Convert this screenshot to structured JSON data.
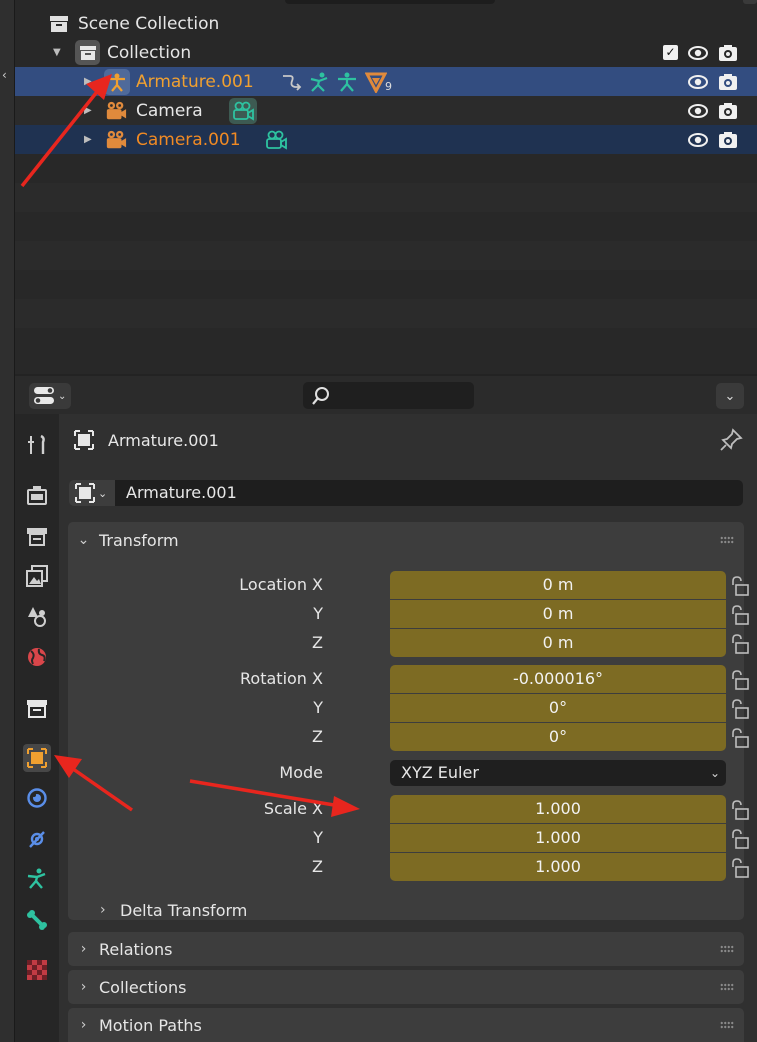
{
  "outliner": {
    "rows": [
      {
        "label": "Scene Collection"
      },
      {
        "label": "Collection"
      },
      {
        "label": "Armature.001",
        "modifier_count": "9"
      },
      {
        "label": "Camera"
      },
      {
        "label": "Camera.001"
      }
    ]
  },
  "properties": {
    "search_placeholder": "",
    "context_title": "Armature.001",
    "object_name": "Armature.001",
    "tabs": [
      "tool-icon",
      "render-icon",
      "output-icon",
      "view-layer-icon",
      "scene-icon",
      "world-icon",
      "collection-icon",
      "object-icon",
      "modifiers-icon",
      "physics-icon",
      "object-data-armature-icon",
      "bone-icon",
      "texture-icon"
    ],
    "active_tab": "object-icon",
    "transform": {
      "title": "Transform",
      "location_label": "Location X",
      "y_label": "Y",
      "z_label": "Z",
      "location": [
        "0 m",
        "0 m",
        "0 m"
      ],
      "rotation_label": "Rotation X",
      "rotation": [
        "-0.000016°",
        "0°",
        "0°"
      ],
      "mode_label": "Mode",
      "mode_value": "XYZ Euler",
      "scale_label": "Scale X",
      "scale": [
        "1.000",
        "1.000",
        "1.000"
      ]
    },
    "delta_transform": "Delta Transform",
    "panels": [
      "Relations",
      "Collections",
      "Motion Paths"
    ]
  },
  "colors": {
    "active_selection": "#334d80",
    "selection": "#1f3251",
    "field_animated": "#7d6b23",
    "object_orange": "#f0a030",
    "annotation_red": "#e8261e",
    "teal": "#2ec2a0"
  }
}
